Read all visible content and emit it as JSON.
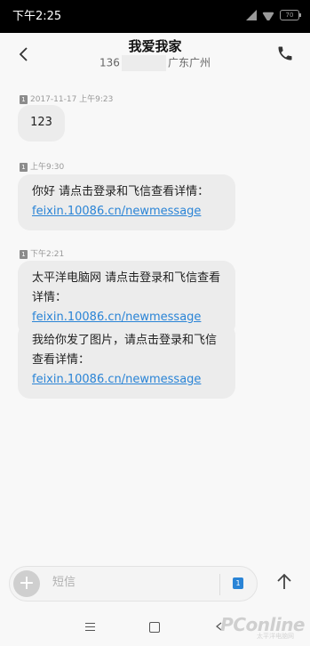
{
  "status_bar": {
    "time": "下午2:25",
    "battery": "70"
  },
  "header": {
    "contact_name": "我爱我家",
    "number_prefix": "136",
    "location": "广东广州"
  },
  "messages": [
    {
      "timestamp": "2017-11-17 上午9:23",
      "sim": "1",
      "bubbles": [
        {
          "text": "123",
          "link": ""
        }
      ]
    },
    {
      "timestamp": "上午9:30",
      "sim": "1",
      "bubbles": [
        {
          "text": "你好 请点击登录和飞信查看详情：",
          "link": "feixin.10086.cn/newmessage"
        }
      ]
    },
    {
      "timestamp": "下午2:21",
      "sim": "1",
      "bubbles": [
        {
          "text": "太平洋电脑网 请点击登录和飞信查看详情：",
          "link": "feixin.10086.cn/newmessage"
        },
        {
          "text": "我给你发了图片，请点击登录和飞信查看详情：",
          "link": "feixin.10086.cn/newmessage"
        }
      ]
    }
  ],
  "composer": {
    "placeholder": "短信",
    "sim": "1"
  },
  "watermark": {
    "brand": "PConline",
    "sub": "太平洋电脑网"
  },
  "colors": {
    "link": "#2a84d6",
    "bubble": "#ececec",
    "background": "#f8f8f8"
  },
  "icons": {
    "back": "chevron-left-icon",
    "call": "phone-icon",
    "add": "plus-icon",
    "send": "arrow-up-icon"
  }
}
